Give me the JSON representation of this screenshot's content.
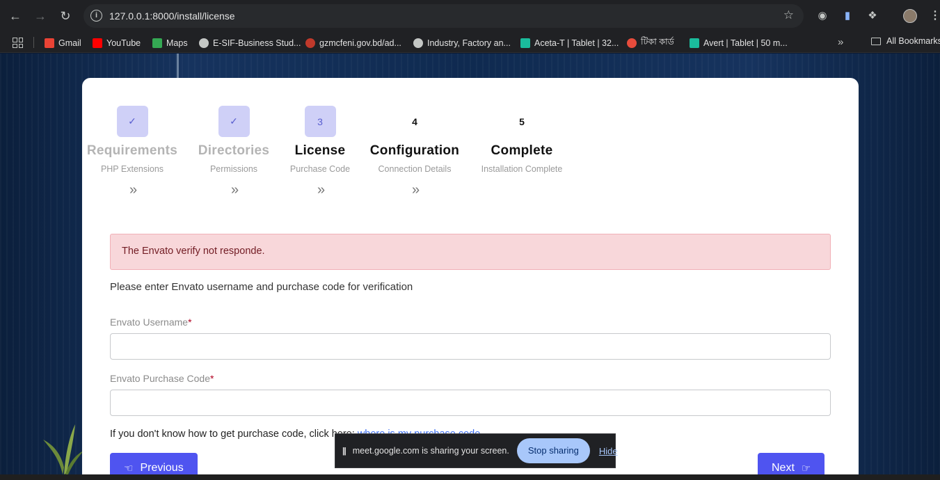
{
  "browser": {
    "url_host": "127.0.0.1:8000",
    "url_path": "/install/license",
    "bookmarks": [
      {
        "label": "Gmail",
        "icon": "gmail-icon",
        "color": "#ea4335"
      },
      {
        "label": "YouTube",
        "icon": "youtube-icon",
        "color": "#ff0000"
      },
      {
        "label": "Maps",
        "icon": "maps-icon",
        "color": "#34a853"
      },
      {
        "label": "E-SIF-Business Stud...",
        "icon": "globe-icon",
        "color": "#c4c7c5"
      },
      {
        "label": "gzmcfeni.gov.bd/ad...",
        "icon": "gov-seal-icon",
        "color": "#c0392b"
      },
      {
        "label": "Industry, Factory an...",
        "icon": "globe-icon",
        "color": "#c4c7c5"
      },
      {
        "label": "Aceta-T | Tablet | 32...",
        "icon": "m-logo-icon",
        "color": "#1abc9c"
      },
      {
        "label": "টিকা কার্ড",
        "icon": "bd-seal-icon",
        "color": "#e74c3c"
      },
      {
        "label": "Avert | Tablet | 50 m...",
        "icon": "m-logo-icon",
        "color": "#1abc9c"
      }
    ],
    "all_bookmarks": "All Bookmarks"
  },
  "steps": [
    {
      "number": "✓",
      "title": "Requirements",
      "subtitle": "PHP Extensions",
      "state": "done"
    },
    {
      "number": "✓",
      "title": "Directories",
      "subtitle": "Permissions",
      "state": "done"
    },
    {
      "number": "3",
      "title": "License",
      "subtitle": "Purchase Code",
      "state": "active"
    },
    {
      "number": "4",
      "title": "Configuration",
      "subtitle": "Connection Details",
      "state": "pending"
    },
    {
      "number": "5",
      "title": "Complete",
      "subtitle": "Installation Complete",
      "state": "pending"
    }
  ],
  "alert": "The Envato verify not responde.",
  "instruction": "Please enter Envato username and purchase code for verification",
  "form": {
    "username_label": "Envato Username",
    "username_value": "",
    "purchase_label": "Envato Purchase Code",
    "purchase_value": "",
    "required_mark": "*"
  },
  "help": {
    "text": "If you don't know how to get purchase code, click here:",
    "link": "where is my purchase code"
  },
  "buttons": {
    "previous": "Previous",
    "next": "Next"
  },
  "sharebar": {
    "message": "meet.google.com is sharing your screen.",
    "stop": "Stop sharing",
    "hide": "Hide"
  },
  "colors": {
    "accent": "#4f54f0",
    "step_badge": "#cfd0f7",
    "alert_bg": "#f8d7da",
    "alert_text": "#721c24"
  }
}
